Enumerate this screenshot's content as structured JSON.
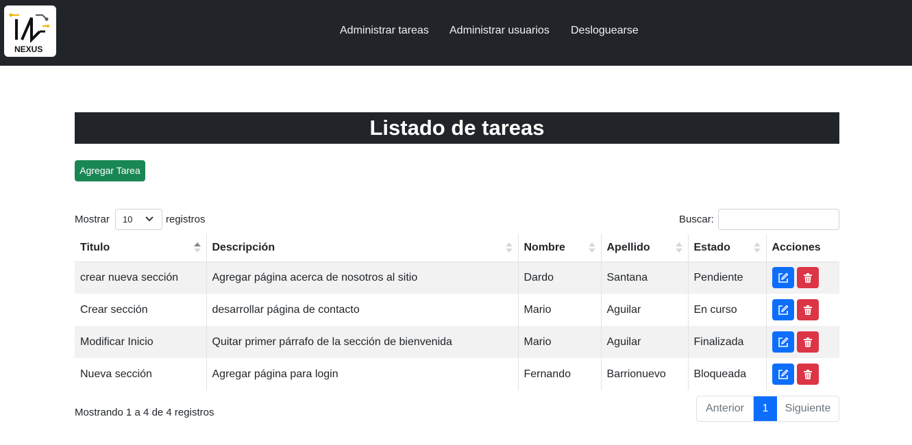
{
  "nav": {
    "logo_text": "NEXUS",
    "links": [
      "Administrar tareas",
      "Administrar usuarios",
      "Desloguearse"
    ]
  },
  "page": {
    "title": "Listado de tareas",
    "add_button": "Agregar Tarea"
  },
  "length_control": {
    "prefix": "Mostrar",
    "value": "10",
    "suffix": "registros"
  },
  "search": {
    "label": "Buscar:",
    "value": ""
  },
  "table": {
    "columns": [
      "Titulo",
      "Descripción",
      "Nombre",
      "Apellido",
      "Estado",
      "Acciones"
    ],
    "sorted_column": "Titulo",
    "sort_direction": "asc",
    "rows": [
      [
        "crear nueva sección",
        "Agregar página acerca de nosotros al sitio",
        "Dardo",
        "Santana",
        "Pendiente"
      ],
      [
        "Crear sección",
        "desarrollar página de contacto",
        "Mario",
        "Aguilar",
        "En curso"
      ],
      [
        "Modificar Inicio",
        "Quitar primer párrafo de la sección de bienvenida",
        "Mario",
        "Aguilar",
        "Finalizada"
      ],
      [
        "Nueva sección",
        "Agregar página para login",
        "Fernando",
        "Barrionuevo",
        "Bloqueada"
      ]
    ],
    "action_icons": [
      "edit-icon",
      "trash-icon"
    ]
  },
  "footer": {
    "info": "Mostrando 1 a 4 de 4 registros",
    "pagination": [
      "Anterior",
      "1",
      "Siguiente"
    ]
  },
  "colors": {
    "navbar": "#212529",
    "primary": "#0d6efd",
    "success": "#198754",
    "danger": "#dc3545"
  }
}
